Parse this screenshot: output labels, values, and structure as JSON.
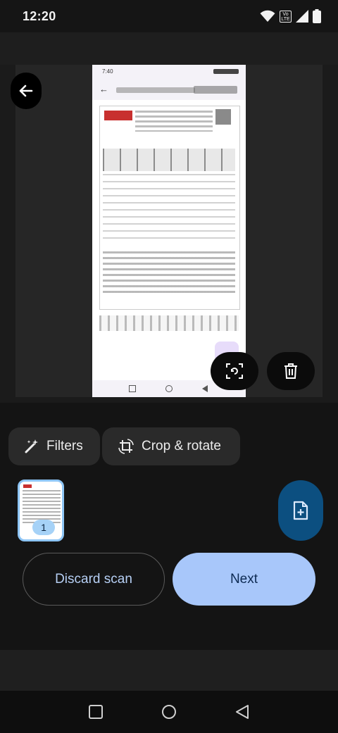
{
  "status_bar": {
    "time": "12:20",
    "volte": "Vo LTE"
  },
  "preview": {
    "inner_time": "7:40"
  },
  "toolbar": {
    "filters_label": "Filters",
    "crop_rotate_label": "Crop & rotate"
  },
  "pages": {
    "thumb_count": "1"
  },
  "actions": {
    "discard_label": "Discard scan",
    "next_label": "Next"
  },
  "colors": {
    "accent": "#a8c7fa",
    "fab": "#0c4f80",
    "thumb_border": "#8ec5f5",
    "background": "#141414"
  }
}
